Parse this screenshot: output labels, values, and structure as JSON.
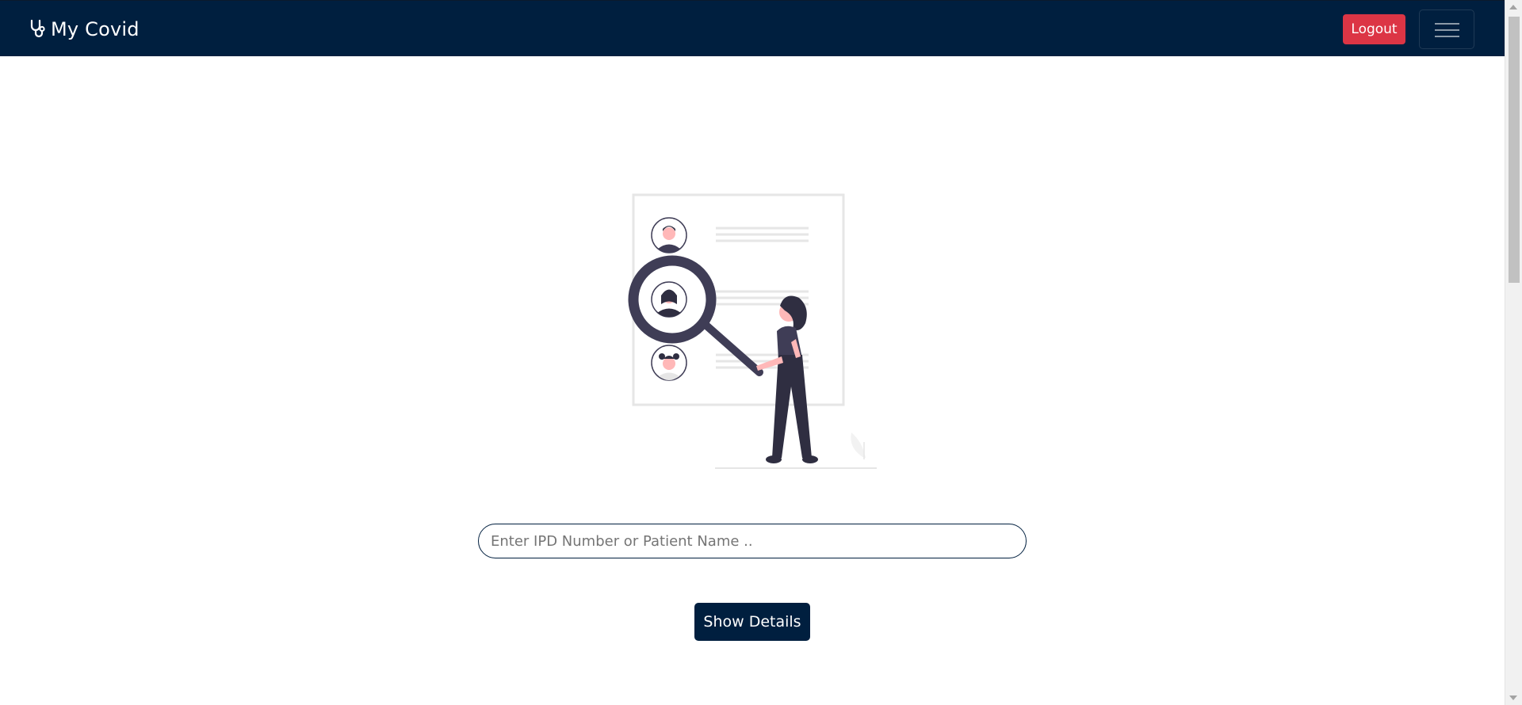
{
  "navbar": {
    "brand_text": "My Covid",
    "brand_icon": "stethoscope-icon",
    "logout_label": "Logout",
    "menu_icon": "hamburger-menu-icon"
  },
  "colors": {
    "navbar_bg": "#001f3f",
    "logout_bg": "#dc3545",
    "primary": "#001f3f",
    "illustration_accent": "#3f3d56",
    "illustration_skin": "#ffb8b8"
  },
  "illustration": {
    "icon": "search-patient-illustration"
  },
  "search": {
    "placeholder": "Enter IPD Number or Patient Name ..",
    "value": ""
  },
  "actions": {
    "show_details_label": "Show Details"
  }
}
